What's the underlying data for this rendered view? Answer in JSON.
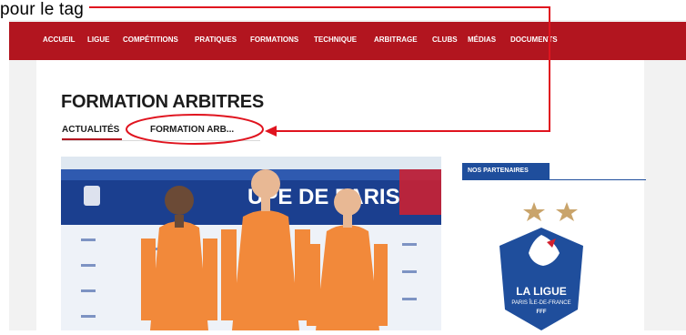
{
  "caption": "pour le tag",
  "nav": {
    "items": [
      "ACCUEIL",
      "LIGUE",
      "COMPÉTITIONS",
      "PRATIQUES",
      "FORMATIONS",
      "TECHNIQUE",
      "ARBITRAGE",
      "CLUBS",
      "MÉDIAS",
      "DOCUMENTS"
    ]
  },
  "page": {
    "title": "FORMATION ARBITRES",
    "tabs": [
      "ACTUALITÉS",
      "FORMATION ARB..."
    ]
  },
  "photo": {
    "banner_text": "UPE DE PARIS"
  },
  "sidebar": {
    "partners_label": "NOS PARTENAIRES"
  },
  "logo": {
    "line1": "LA LIGUE",
    "line2": "PARIS ÎLE-DE-FRANCE",
    "line3": "FFF"
  },
  "colors": {
    "nav_red": "#b2151f",
    "partners_blue": "#1f4e9c",
    "referee_orange": "#f2893a"
  }
}
